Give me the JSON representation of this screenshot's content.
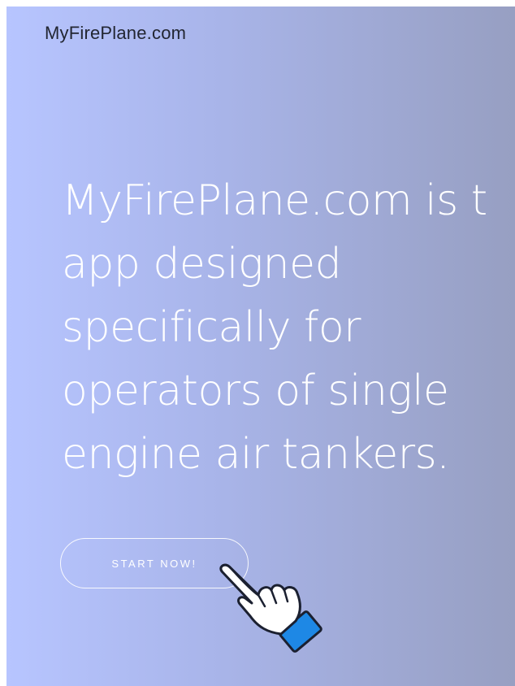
{
  "header": {
    "logo_text": "MyFirePlane.com"
  },
  "hero": {
    "headline_lines": [
      "MyFirePlane.com is t",
      "app designed",
      "specifically for",
      "operators of single",
      "engine air tankers."
    ],
    "cta_label": "START NOW!"
  },
  "icons": {
    "pointer": "hand-pointer-icon"
  },
  "colors": {
    "gradient_start": "#b7c5ff",
    "gradient_end": "#979fc2",
    "text": "#ffffff",
    "logo_text": "#222632",
    "cuff": "#1e88e5"
  }
}
